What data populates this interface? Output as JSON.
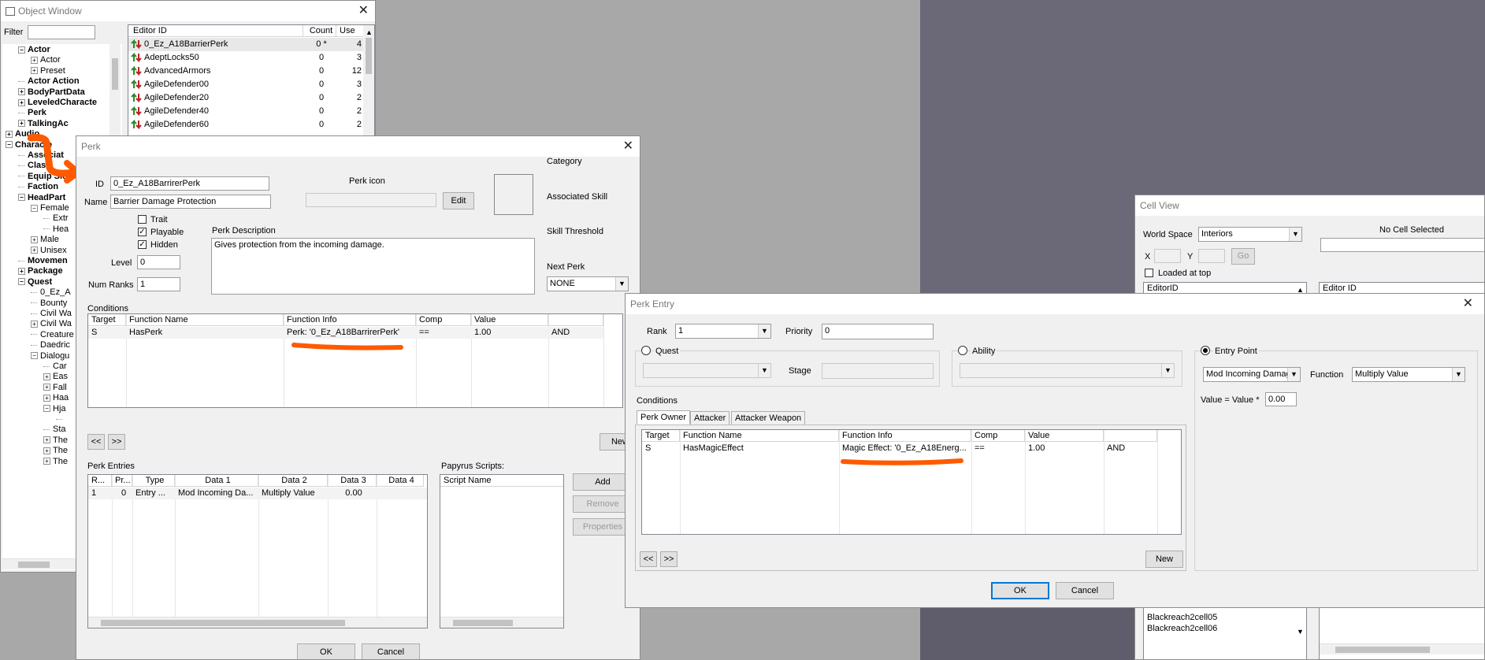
{
  "object_window": {
    "title": "Object Window",
    "filter_label": "Filter",
    "filter_value": "",
    "columns": [
      "Editor ID",
      "Count",
      "Use"
    ],
    "rows": [
      {
        "id": "0_Ez_A18BarrierPerk",
        "count": "0 *",
        "use": "4"
      },
      {
        "id": "AdeptLocks50",
        "count": "0",
        "use": "3"
      },
      {
        "id": "AdvancedArmors",
        "count": "0",
        "use": "12"
      },
      {
        "id": "AgileDefender00",
        "count": "0",
        "use": "3"
      },
      {
        "id": "AgileDefender20",
        "count": "0",
        "use": "2"
      },
      {
        "id": "AgileDefender40",
        "count": "0",
        "use": "2"
      },
      {
        "id": "AgileDefender60",
        "count": "0",
        "use": "2"
      }
    ],
    "tree": [
      {
        "label": "Actor",
        "indent": 1,
        "bold": true,
        "exp": "-"
      },
      {
        "label": "Actor",
        "indent": 2,
        "bold": false,
        "exp": "+"
      },
      {
        "label": "Preset",
        "indent": 2,
        "bold": false,
        "exp": "+"
      },
      {
        "label": "Actor Action",
        "indent": 1,
        "bold": true,
        "exp": ""
      },
      {
        "label": "BodyPartData",
        "indent": 1,
        "bold": true,
        "exp": "+"
      },
      {
        "label": "LeveledCharacte",
        "indent": 1,
        "bold": true,
        "exp": "+"
      },
      {
        "label": "Perk",
        "indent": 1,
        "bold": true,
        "exp": ""
      },
      {
        "label": "TalkingAc",
        "indent": 1,
        "bold": true,
        "exp": "+"
      },
      {
        "label": "Audio",
        "indent": 0,
        "bold": true,
        "exp": "+"
      },
      {
        "label": "Characte",
        "indent": 0,
        "bold": true,
        "exp": "-"
      },
      {
        "label": "Associat",
        "indent": 1,
        "bold": true,
        "exp": ""
      },
      {
        "label": "Class",
        "indent": 1,
        "bold": true,
        "exp": ""
      },
      {
        "label": "Equip Slot",
        "indent": 1,
        "bold": true,
        "exp": ""
      },
      {
        "label": "Faction",
        "indent": 1,
        "bold": true,
        "exp": ""
      },
      {
        "label": "HeadPart",
        "indent": 1,
        "bold": true,
        "exp": "-"
      },
      {
        "label": "Female",
        "indent": 2,
        "bold": false,
        "exp": "-"
      },
      {
        "label": "Extr",
        "indent": 3,
        "bold": false,
        "exp": ""
      },
      {
        "label": "Hea",
        "indent": 3,
        "bold": false,
        "exp": ""
      },
      {
        "label": "Male",
        "indent": 2,
        "bold": false,
        "exp": "+"
      },
      {
        "label": "Unisex",
        "indent": 2,
        "bold": false,
        "exp": "+"
      },
      {
        "label": "Movemen",
        "indent": 1,
        "bold": true,
        "exp": ""
      },
      {
        "label": "Package",
        "indent": 1,
        "bold": true,
        "exp": "+"
      },
      {
        "label": "Quest",
        "indent": 1,
        "bold": true,
        "exp": "-"
      },
      {
        "label": "0_Ez_A",
        "indent": 2,
        "bold": false,
        "exp": ""
      },
      {
        "label": "Bounty",
        "indent": 2,
        "bold": false,
        "exp": ""
      },
      {
        "label": "Civil Wa",
        "indent": 2,
        "bold": false,
        "exp": ""
      },
      {
        "label": "Civil Wa",
        "indent": 2,
        "bold": false,
        "exp": "+"
      },
      {
        "label": "Creature",
        "indent": 2,
        "bold": false,
        "exp": ""
      },
      {
        "label": "Daedric",
        "indent": 2,
        "bold": false,
        "exp": ""
      },
      {
        "label": "Dialogu",
        "indent": 2,
        "bold": false,
        "exp": "-"
      },
      {
        "label": "Car",
        "indent": 3,
        "bold": false,
        "exp": ""
      },
      {
        "label": "Eas",
        "indent": 3,
        "bold": false,
        "exp": "+"
      },
      {
        "label": "Fall",
        "indent": 3,
        "bold": false,
        "exp": "+"
      },
      {
        "label": "Haa",
        "indent": 3,
        "bold": false,
        "exp": "+"
      },
      {
        "label": "Hja",
        "indent": 3,
        "bold": false,
        "exp": "-"
      },
      {
        "label": "",
        "indent": 4,
        "bold": false,
        "exp": ""
      },
      {
        "label": "Sta",
        "indent": 3,
        "bold": false,
        "exp": ""
      },
      {
        "label": "The",
        "indent": 3,
        "bold": false,
        "exp": "+"
      },
      {
        "label": "The",
        "indent": 3,
        "bold": false,
        "exp": "+"
      },
      {
        "label": "The",
        "indent": 3,
        "bold": false,
        "exp": "+"
      }
    ]
  },
  "perk": {
    "title": "Perk",
    "id_label": "ID",
    "id_value": "0_Ez_A18BarrirerPerk",
    "name_label": "Name",
    "name_value": "Barrier Damage Protection",
    "perk_icon_label": "Perk icon",
    "edit_label": "Edit",
    "trait_label": "Trait",
    "playable_label": "Playable",
    "hidden_label": "Hidden",
    "trait_checked": "",
    "playable_checked": "✓",
    "hidden_checked": "✓",
    "level_label": "Level",
    "level_value": "0",
    "num_ranks_label": "Num Ranks",
    "num_ranks_value": "1",
    "desc_label": "Perk Description",
    "desc_value": "Gives protection from the incoming damage.",
    "category_label": "Category",
    "assoc_skill_label": "Associated Skill",
    "skill_threshold_label": "Skill Threshold",
    "next_perk_label": "Next Perk",
    "next_perk_value": "NONE",
    "conditions_label": "Conditions",
    "cond_columns": [
      "Target",
      "Function Name",
      "Function Info",
      "Comp",
      "Value",
      ""
    ],
    "cond_row": {
      "target": "S",
      "fn": "HasPerk",
      "info": "Perk: '0_Ez_A18BarrirerPerk'",
      "comp": "==",
      "value": "1.00",
      "op": "AND"
    },
    "prev_label": "<<",
    "next_label": ">>",
    "new_label": "New",
    "entries_label": "Perk Entries",
    "entry_columns": [
      "R...",
      "Pr...",
      "Type",
      "Data 1",
      "Data 2",
      "Data 3",
      "Data 4"
    ],
    "entry_row": {
      "r": "1",
      "pr": "0",
      "type": "Entry ...",
      "d1": "Mod Incoming Da...",
      "d2": "Multiply Value",
      "d3": "0.00",
      "d4": ""
    },
    "papyrus_label": "Papyrus Scripts:",
    "script_col": "Script Name",
    "add_label": "Add",
    "remove_label": "Remove",
    "properties_label": "Properties",
    "ok_label": "OK",
    "cancel_label": "Cancel"
  },
  "cell_view": {
    "title": "Cell View",
    "world_space_label": "World Space",
    "world_space_value": "Interiors",
    "no_cell": "No Cell Selected",
    "x_label": "X",
    "y_label": "Y",
    "go_label": "Go",
    "loaded_label": "Loaded at top",
    "editor_id_col": "EditorID",
    "editor_id_col2": "Editor ID",
    "cells": [
      "Blackreach2cell05",
      "Blackreach2cell06"
    ]
  },
  "perk_entry": {
    "title": "Perk Entry",
    "rank_label": "Rank",
    "rank_value": "1",
    "priority_label": "Priority",
    "priority_value": "0",
    "quest_label": "Quest",
    "stage_label": "Stage",
    "ability_label": "Ability",
    "entry_point_label": "Entry Point",
    "entry_point_value": "Mod Incoming Damag",
    "function_label": "Function",
    "function_value": "Multiply Value",
    "value_eq_label": "Value = Value *",
    "value_eq_value": "0.00",
    "conditions_label": "Conditions",
    "tabs": [
      "Perk Owner",
      "Attacker",
      "Attacker Weapon"
    ],
    "cond_columns": [
      "Target",
      "Function Name",
      "Function Info",
      "Comp",
      "Value",
      ""
    ],
    "cond_row": {
      "target": "S",
      "fn": "HasMagicEffect",
      "info": "Magic Effect: '0_Ez_A18Energ...",
      "comp": "==",
      "value": "1.00",
      "op": "AND"
    },
    "prev_label": "<<",
    "next_label": ">>",
    "new_label": "New",
    "ok_label": "OK",
    "cancel_label": "Cancel"
  },
  "colors": {
    "annotation": "#ff5a00",
    "accent": "#0078d7",
    "viewport": "#6b6878"
  }
}
